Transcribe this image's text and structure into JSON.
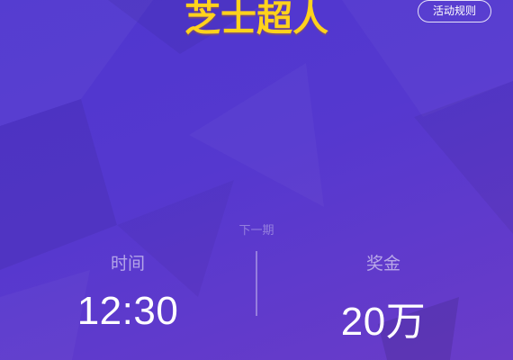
{
  "header": {
    "title": "芝士超人",
    "rules_button": "活动规则"
  },
  "next_round": {
    "label": "下一期",
    "time_label": "时间",
    "time_value": "12:30",
    "prize_label": "奖金",
    "prize_value": "20万"
  },
  "colors": {
    "background": "#5538cf",
    "title": "#ffd21c"
  }
}
